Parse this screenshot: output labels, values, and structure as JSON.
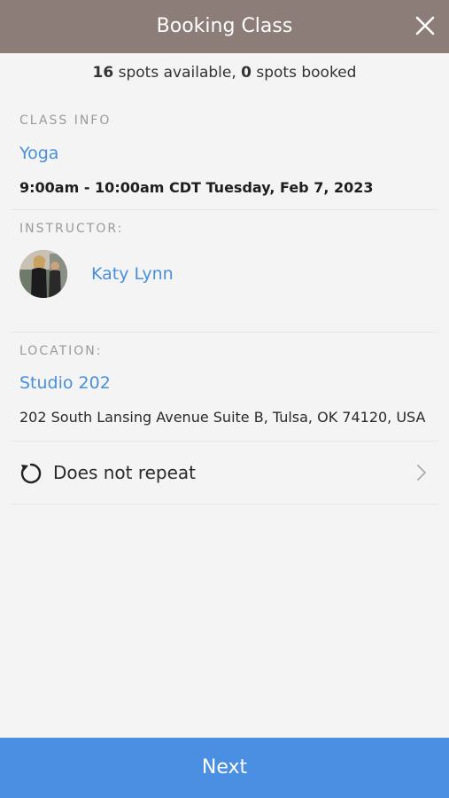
{
  "header": {
    "title": "Booking Class"
  },
  "spots": {
    "available_count": "16",
    "available_text": " spots available, ",
    "booked_count": "0",
    "booked_text": " spots booked"
  },
  "class_info": {
    "label": "CLASS INFO",
    "class_name": "Yoga",
    "datetime": "9:00am - 10:00am CDT Tuesday, Feb 7, 2023"
  },
  "instructor": {
    "label": "INSTRUCTOR:",
    "name": "Katy Lynn"
  },
  "location": {
    "label": "LOCATION:",
    "name": "Studio 202",
    "address": "202 South Lansing Avenue Suite B, Tulsa, OK 74120, USA"
  },
  "repeat": {
    "label": "Does not repeat"
  },
  "footer": {
    "next_label": "Next"
  },
  "colors": {
    "header_bg": "#8c7d78",
    "link": "#4a8fd9",
    "primary_button": "#4a8fe2",
    "background": "#f4f4f4"
  },
  "icons": [
    "close-icon",
    "repeat-icon",
    "chevron-right-icon"
  ]
}
